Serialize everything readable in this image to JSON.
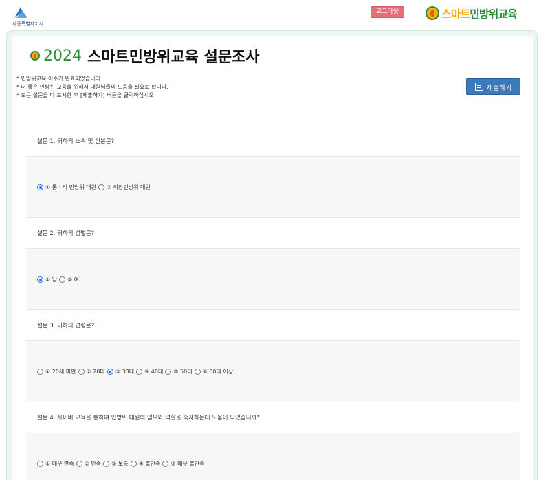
{
  "header": {
    "city_logo_text": "세종특별자치시",
    "logout_label": "로그아웃",
    "brand": {
      "part1": "스마트",
      "part2": "민방위교육"
    }
  },
  "title": {
    "year": "2024",
    "main": "스마트민방위교육 설문조사"
  },
  "notes": [
    "* 민방위교육 이수가 완료되었습니다.",
    "* 더 좋은 민방위 교육을 위해서 대원님들의 도움을 필요로 합니다.",
    "* 모든 설문을 다 표시한 후 [제출하기] 버튼을 클릭하십시오"
  ],
  "submit_label": "제출하기",
  "questions": [
    {
      "text": "설문 1. 귀하의 소속 및 신분은?",
      "options": [
        {
          "label": "① 통 · 리 민방위 대원",
          "checked": true
        },
        {
          "label": "② 직장민방위 대원",
          "checked": false
        }
      ]
    },
    {
      "text": "설문 2. 귀하의 성별은?",
      "options": [
        {
          "label": "① 남",
          "checked": true
        },
        {
          "label": "② 여",
          "checked": false
        }
      ]
    },
    {
      "text": "설문 3. 귀하의 연령은?",
      "options": [
        {
          "label": "① 20세 미만",
          "checked": false
        },
        {
          "label": "② 20대",
          "checked": false
        },
        {
          "label": "③ 30대",
          "checked": true
        },
        {
          "label": "④ 40대",
          "checked": false
        },
        {
          "label": "⑤ 50대",
          "checked": false
        },
        {
          "label": "⑥ 60대 이상",
          "checked": false
        }
      ]
    },
    {
      "text": "설문 4. 사이버 교육을 통하여 민방위 대원의 임무와 역할을 숙지하는데 도움이 되었습니까?",
      "options": [
        {
          "label": "① 매우 만족",
          "checked": false
        },
        {
          "label": "② 만족",
          "checked": false
        },
        {
          "label": "③ 보통",
          "checked": false
        },
        {
          "label": "④ 불만족",
          "checked": false
        },
        {
          "label": "⑤ 매우 불만족",
          "checked": false
        }
      ]
    }
  ],
  "colors": {
    "brand_green": "#2d8a3e",
    "brand_yellow": "#f2a900",
    "submit_blue": "#3f79b9",
    "logout_red": "#e86d7a",
    "radio_checked": "#1a73e8"
  }
}
